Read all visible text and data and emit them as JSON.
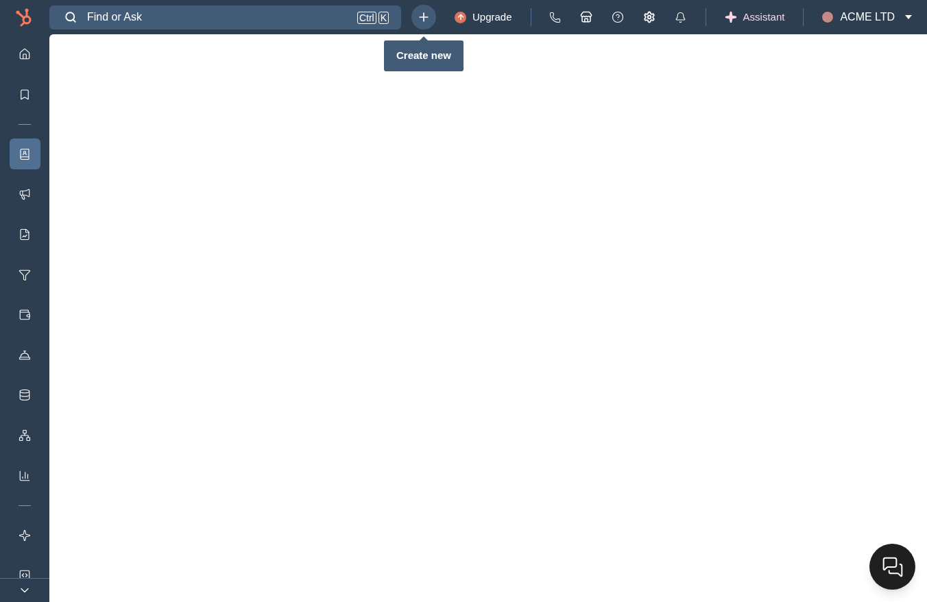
{
  "search": {
    "placeholder": "Find or Ask",
    "shortcut_keys": [
      "Ctrl",
      "K"
    ]
  },
  "tooltip": {
    "text": "Create new"
  },
  "upgrade": {
    "label": "Upgrade"
  },
  "assistant": {
    "label": "Assistant"
  },
  "account": {
    "name": "ACME LTD"
  },
  "sidebar": {
    "items": [
      {
        "kind": "link",
        "selected": false
      },
      {
        "kind": "link",
        "selected": false
      },
      {
        "kind": "divider"
      },
      {
        "kind": "link",
        "selected": true
      },
      {
        "kind": "link",
        "selected": false
      },
      {
        "kind": "link",
        "selected": false
      },
      {
        "kind": "link",
        "selected": false
      },
      {
        "kind": "link",
        "selected": false
      },
      {
        "kind": "link",
        "selected": false
      },
      {
        "kind": "link",
        "selected": false
      },
      {
        "kind": "link",
        "selected": false
      },
      {
        "kind": "link",
        "selected": false
      },
      {
        "kind": "divider"
      },
      {
        "kind": "link",
        "selected": false
      },
      {
        "kind": "link",
        "selected": false
      }
    ]
  }
}
